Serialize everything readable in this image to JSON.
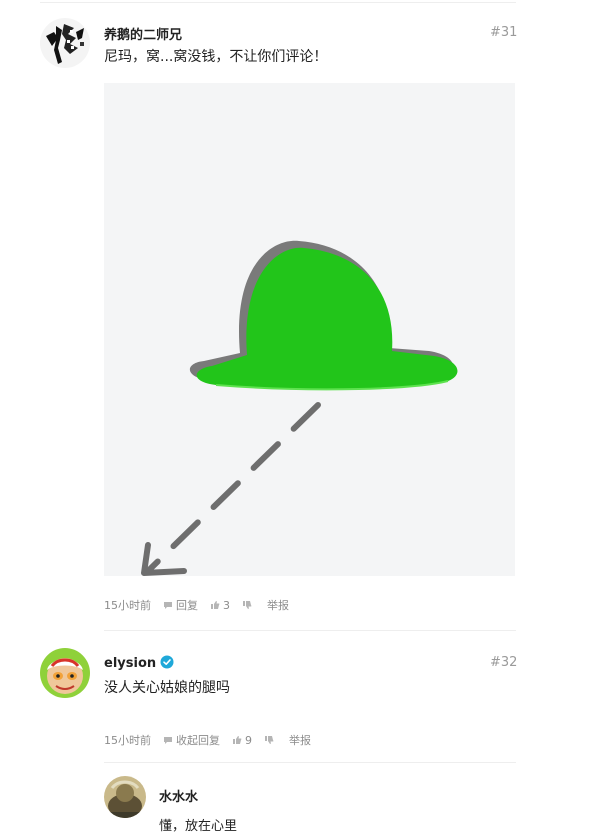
{
  "comments": [
    {
      "username": "养鹅的二师兄",
      "floor": "#31",
      "content": "尼玛，窝...窝没钱，不让你们评论！",
      "image": {
        "description_icon": "green-hat-icon",
        "hat_color": "#22c51a",
        "shadow_color": "#7a7a7a",
        "background_color": "#f4f5f6"
      },
      "meta": {
        "time": "15小时前",
        "reply_label": "回复",
        "like_count": "3",
        "report_label": "举报"
      }
    },
    {
      "username": "elysion",
      "verified": true,
      "verified_color": "#1fa8d9",
      "floor": "#32",
      "content": "没人关心姑娘的腿吗",
      "meta": {
        "time": "15小时前",
        "reply_label": "收起回复",
        "like_count": "9",
        "report_label": "举报"
      },
      "replies": [
        {
          "username": "水水水",
          "content": "懂，放在心里"
        }
      ]
    }
  ]
}
